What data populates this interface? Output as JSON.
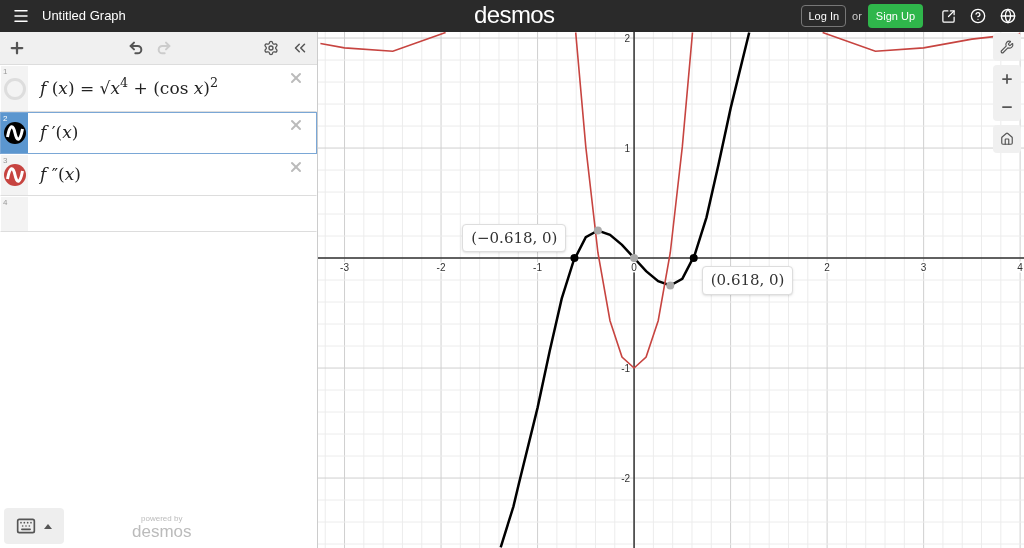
{
  "header": {
    "title": "Untitled Graph",
    "logo": "desmos",
    "login": "Log In",
    "or": "or",
    "signup": "Sign Up"
  },
  "toolbar": {
    "undo_disabled": false,
    "redo_disabled": true
  },
  "expressions": [
    {
      "number": "1",
      "kind": "expression",
      "latex": "*f* (*x*) = √*x*$^{4}$ + (cos *x*)$^{2}$",
      "visible": false,
      "selected": false
    },
    {
      "number": "2",
      "kind": "expression",
      "latex": "*f* ′(*x*)",
      "color": "#000000",
      "visible": true,
      "selected": true
    },
    {
      "number": "3",
      "kind": "expression",
      "latex": "*f* ″(*x*)",
      "color": "#c74440",
      "visible": true,
      "selected": false
    },
    {
      "number": "4",
      "kind": "empty",
      "selected": false
    }
  ],
  "footer": {
    "powered_by": "powered by",
    "brand": "desmos"
  },
  "graph": {
    "chart_data": {
      "type": "line",
      "x": [
        -3.25,
        -3,
        -2.5,
        -1.953,
        -1.382,
        -1.25,
        -1.193,
        -1,
        -0.875,
        -0.75,
        -0.625,
        -0.605,
        -0.5,
        -0.375,
        -0.25,
        -0.125,
        0,
        0.125,
        0.25,
        0.375,
        0.5,
        0.605,
        0.625,
        0.75,
        0.875,
        1,
        1.193,
        1.953,
        2.5,
        3,
        3.5,
        4
      ],
      "series": [
        {
          "color": "#000000",
          "values": [
            null,
            null,
            null,
            null,
            -2.63,
            -2.26,
            -2.05,
            -1.36,
            -0.85,
            -0.37,
            -0.02,
            0.01,
            0.19,
            0.25,
            0.21,
            0.12,
            0,
            -0.12,
            -0.21,
            -0.25,
            -0.19,
            -0.01,
            0.02,
            0.37,
            0.85,
            1.36,
            2.05,
            null,
            null,
            null,
            null,
            null
          ]
        },
        {
          "color": "#c74440",
          "values": [
            1.95,
            1.91,
            1.88,
            2.05,
            null,
            null,
            null,
            null,
            null,
            null,
            null,
            2.05,
            1.01,
            0.05,
            -0.57,
            -0.9,
            -1,
            -0.9,
            -0.57,
            0.05,
            1.01,
            2.05,
            null,
            null,
            null,
            null,
            null,
            2.05,
            1.88,
            1.91,
            1.99,
            2.04
          ]
        }
      ],
      "xlim": [
        -3.275,
        4.04
      ],
      "ylim": [
        -2.636,
        2.055
      ],
      "grid": true,
      "xticks": [
        -3,
        -2,
        -1,
        0,
        2,
        3,
        4
      ],
      "yticks": [
        -2,
        -1,
        1,
        2
      ],
      "annotations": [
        {
          "x": -0.618,
          "y": 0,
          "text": "(−0.618, 0)"
        },
        {
          "x": 0.618,
          "y": 0,
          "text": "(0.618, 0)"
        }
      ]
    }
  }
}
